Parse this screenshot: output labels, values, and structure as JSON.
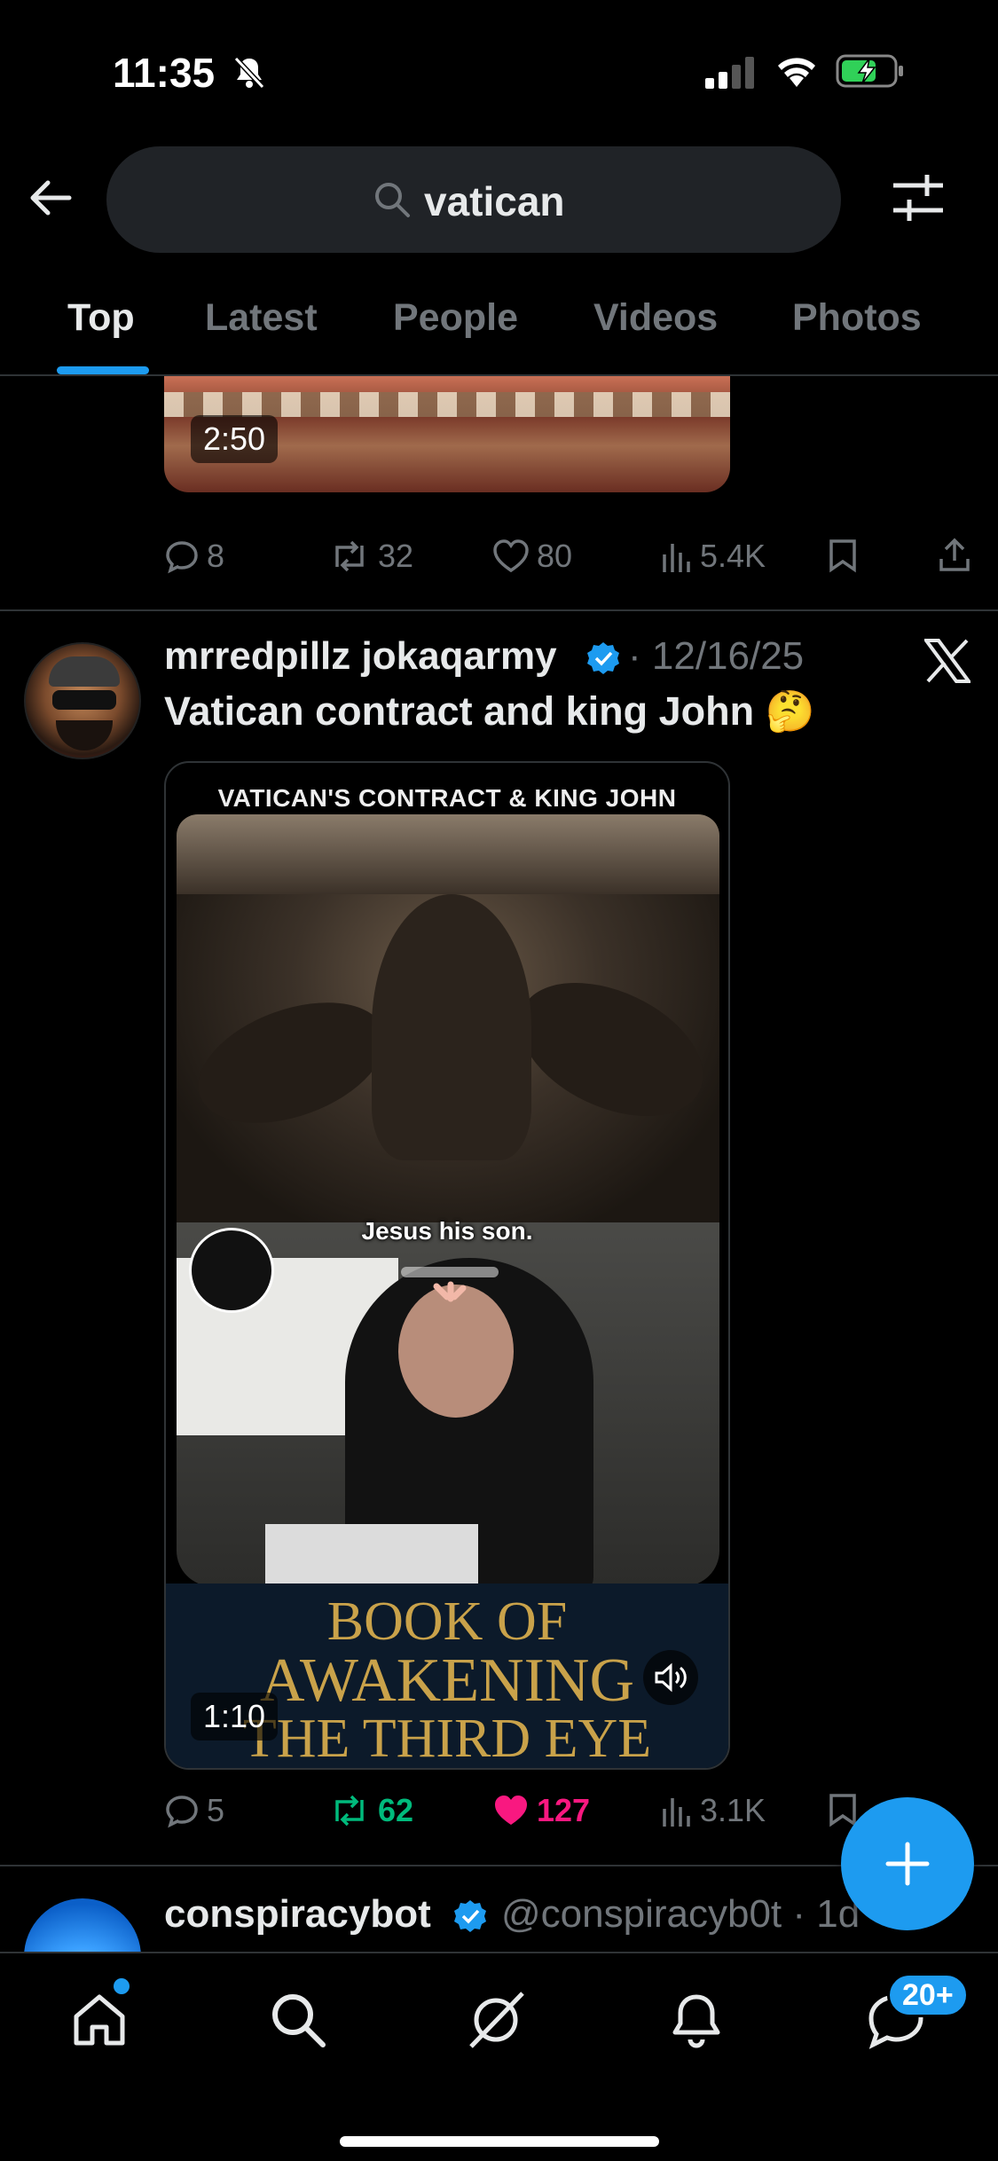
{
  "status_bar": {
    "time": "11:35"
  },
  "search": {
    "query": "vatican"
  },
  "tabs": [
    {
      "label": "Top",
      "active": true
    },
    {
      "label": "Latest",
      "active": false
    },
    {
      "label": "People",
      "active": false
    },
    {
      "label": "Videos",
      "active": false
    },
    {
      "label": "Photos",
      "active": false
    }
  ],
  "post_prev": {
    "video_duration": "2:50",
    "replies": "8",
    "reposts": "32",
    "likes": "80",
    "views": "5.4K"
  },
  "post_main": {
    "author": "mrredpillz jokaqarmy",
    "date": "· 12/16/25",
    "text": "Vatican contract and king John 🤔",
    "video_title": "VATICAN'S CONTRACT & KING JOHN",
    "video_caption": "Jesus his son.",
    "book_line1": "BOOK OF",
    "book_line2": "AWAKENING",
    "book_line3": "THE THIRD EYE",
    "video_duration": "1:10",
    "replies": "5",
    "reposts": "62",
    "likes": "127",
    "views": "3.1K",
    "repost_color": "#00ba7c",
    "like_color": "#f91880"
  },
  "post_next": {
    "author": "conspiracybot",
    "handle": "@conspiracyb0t · 1d"
  },
  "bottom_nav": {
    "messages_badge": "20+"
  },
  "colors": {
    "accent": "#1d9bf0",
    "muted": "#71767b"
  }
}
